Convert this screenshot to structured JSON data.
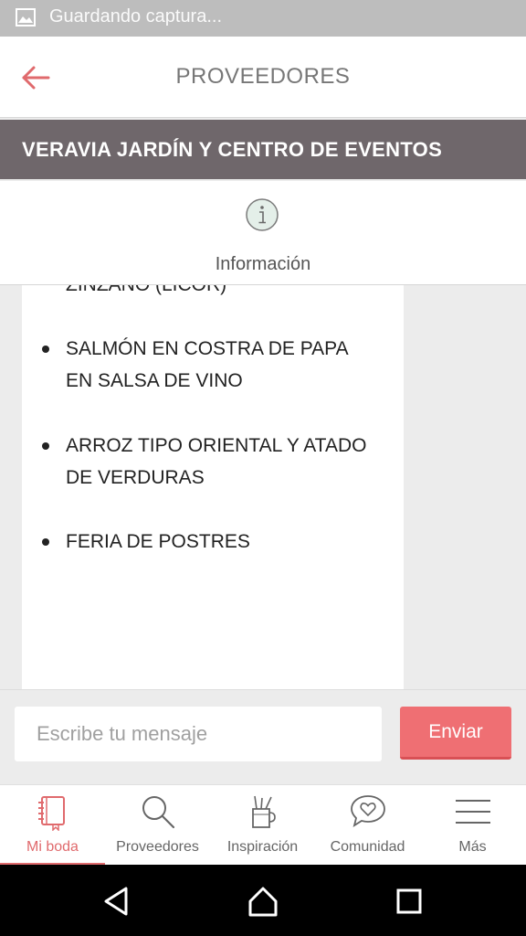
{
  "status_bar": {
    "text": "Guardando captura..."
  },
  "app_bar": {
    "title": "PROVEEDORES"
  },
  "vendor": {
    "name": "VERAVIA JARDÍN Y CENTRO DE EVENTOS"
  },
  "tab": {
    "label": "Información"
  },
  "menu": {
    "items": [
      {
        "text": "ZINZANO (LICOR)"
      },
      {
        "text": "SALMÓN EN COSTRA DE PAPA EN SALSA DE VINO"
      },
      {
        "text": "ARROZ TIPO ORIENTAL Y ATADO DE VERDURAS"
      },
      {
        "text": "FERIA DE POSTRES"
      }
    ]
  },
  "composer": {
    "placeholder": "Escribe tu mensaje",
    "send_label": "Enviar"
  },
  "bottom_nav": {
    "items": [
      {
        "label": "Mi boda",
        "icon": "notebook-icon",
        "active": true
      },
      {
        "label": "Proveedores",
        "icon": "search-icon",
        "active": false
      },
      {
        "label": "Inspiración",
        "icon": "pencil-cup-icon",
        "active": false
      },
      {
        "label": "Comunidad",
        "icon": "chat-heart-icon",
        "active": false
      },
      {
        "label": "Más",
        "icon": "menu-icon",
        "active": false
      }
    ]
  },
  "colors": {
    "accent": "#e06a6d",
    "banner": "#6f676b",
    "send_button": "#ef6f73",
    "status_bar": "#bdbdbd"
  }
}
